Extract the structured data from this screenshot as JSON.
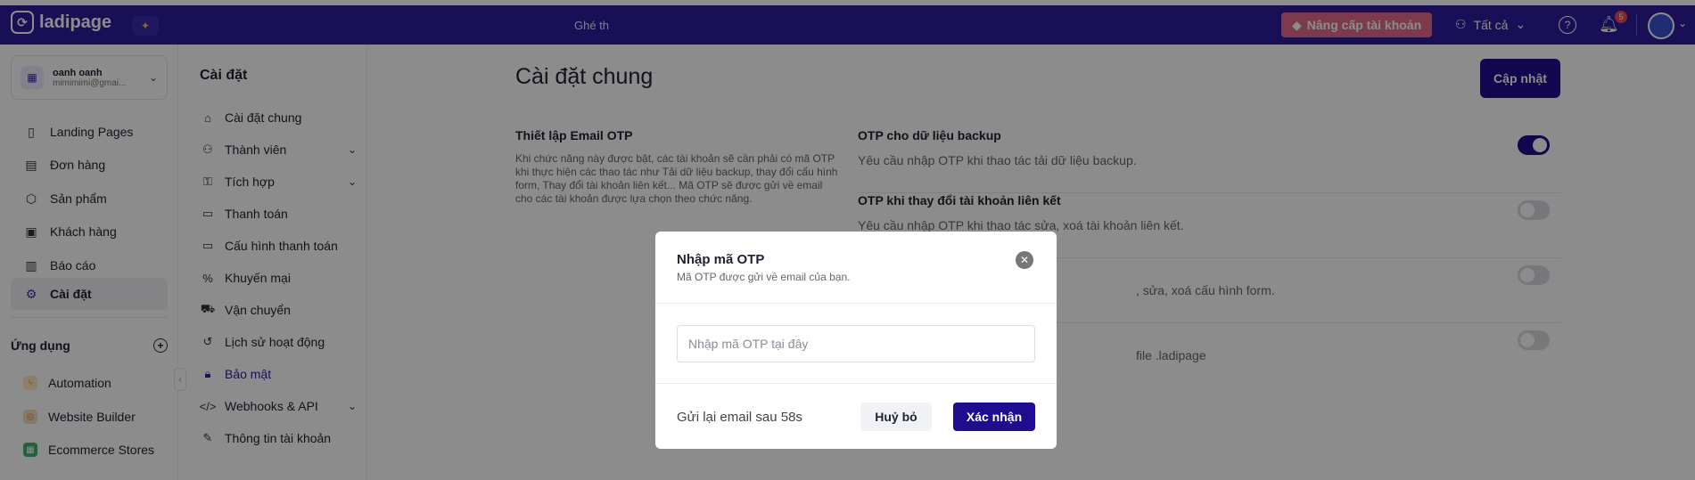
{
  "app": {
    "brand": "ladipage"
  },
  "topbar": {
    "center_text": "Ghé th",
    "upgrade_label": "Nâng cấp tài khoản",
    "filter_label": "Tất cả",
    "notification_count": "5"
  },
  "account": {
    "name": "oanh oanh",
    "email": "mimimimi@gmai..."
  },
  "sidebar": {
    "items": [
      {
        "label": "Landing Pages",
        "icon": "landing-pages-icon"
      },
      {
        "label": "Đơn hàng",
        "icon": "orders-icon"
      },
      {
        "label": "Sản phẩm",
        "icon": "products-icon"
      },
      {
        "label": "Khách hàng",
        "icon": "customers-icon"
      },
      {
        "label": "Báo cáo",
        "icon": "reports-icon"
      },
      {
        "label": "Cài đặt",
        "icon": "gear-icon",
        "active": true
      }
    ],
    "apps_title": "Ứng dụng",
    "apps": [
      {
        "label": "Automation",
        "icon": "automation-icon",
        "color": "#f5a623"
      },
      {
        "label": "Website Builder",
        "icon": "website-builder-icon",
        "color": "#d9822b"
      },
      {
        "label": "Ecommerce Stores",
        "icon": "store-icon",
        "color": "#3bb26d"
      }
    ]
  },
  "settings_nav": {
    "title": "Cài đặt",
    "items": [
      {
        "label": "Cài đặt chung",
        "icon": "home-icon"
      },
      {
        "label": "Thành viên",
        "icon": "members-icon",
        "expandable": true
      },
      {
        "label": "Tích hợp",
        "icon": "integration-icon",
        "expandable": true
      },
      {
        "label": "Thanh toán",
        "icon": "payment-icon"
      },
      {
        "label": "Cấu hình thanh toán",
        "icon": "payment-config-icon"
      },
      {
        "label": "Khuyến mại",
        "icon": "discount-icon"
      },
      {
        "label": "Vận chuyển",
        "icon": "shipping-icon"
      },
      {
        "label": "Lịch sử hoạt động",
        "icon": "history-icon"
      },
      {
        "label": "Bảo mật",
        "icon": "lock-icon",
        "active": true
      },
      {
        "label": "Webhooks & API",
        "icon": "code-icon",
        "expandable": true
      },
      {
        "label": "Thông tin tài khoản",
        "icon": "account-info-icon"
      }
    ]
  },
  "main": {
    "title": "Cài đặt chung",
    "update_label": "Cập nhật",
    "section_title": "Thiết lập Email OTP",
    "section_desc": "Khi chức năng này được bật, các tài khoản sẽ cần phải có mã OTP khi thực hiện các thao tác như Tải dữ liệu backup, thay đổi cấu hình form, Thay đổi tài khoản liên kết... Mã OTP sẽ được gửi về email cho các tài khoản được lựa chọn theo chức năng.",
    "options": [
      {
        "title": "OTP cho dữ liệu backup",
        "desc": "Yêu cầu nhập OTP khi thao tác tải dữ liệu backup.",
        "enabled": true
      },
      {
        "title": "OTP khi thay đổi tài khoản liên kết",
        "desc": "Yêu cầu nhập OTP khi thao tác sửa, xoá tài khoản liên kết.",
        "enabled": false
      },
      {
        "title": "",
        "desc": ", sửa, xoá cấu hình form.",
        "enabled": false
      },
      {
        "title": "",
        "desc": "file .ladipage",
        "enabled": false
      }
    ]
  },
  "modal": {
    "title": "Nhập mã OTP",
    "subtitle": "Mã OTP được gửi về email của bạn.",
    "input_placeholder": "Nhập mã OTP tại đây",
    "input_value": "",
    "resend_text": "Gửi lại email sau 58s",
    "cancel_label": "Huỷ bỏ",
    "confirm_label": "Xác nhận"
  }
}
